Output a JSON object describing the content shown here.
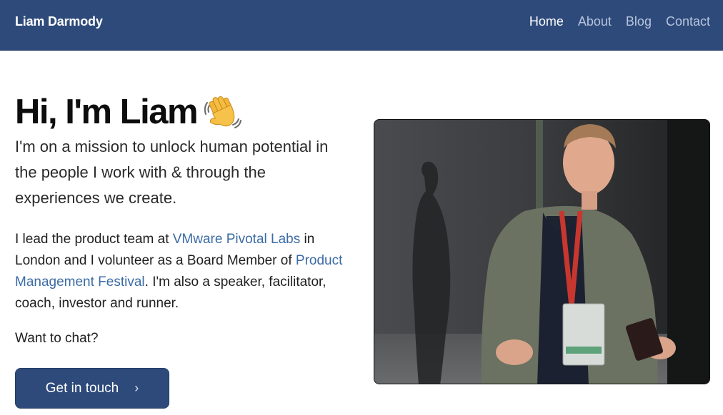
{
  "navbar": {
    "brand": "Liam Darmody",
    "links": [
      {
        "label": "Home",
        "active": true
      },
      {
        "label": "About",
        "active": false
      },
      {
        "label": "Blog",
        "active": false
      },
      {
        "label": "Contact",
        "active": false
      }
    ]
  },
  "hero": {
    "title": "Hi, I'm Liam",
    "wave_icon": "waving-hand-emoji",
    "tagline": "I'm on a mission to unlock human potential in the people I work with & through the experiences we create.",
    "bio": {
      "part1": "I lead the product team at ",
      "link1": "VMware Pivotal Labs",
      "part2": " in London and I volunteer as a Board Member of ",
      "link2": "Product Management Festival",
      "part3": ". I'm also a speaker, facilitator, coach, investor and runner."
    },
    "chat_prompt": "Want to chat?",
    "cta_label": "Get in touch",
    "cta_icon": "chevron-right-icon"
  },
  "photo": {
    "subject": "speaker-on-stage-photo"
  },
  "colors": {
    "navbar_bg": "#2d4a7a",
    "link": "#3b6ba5",
    "cta_bg": "#2d4a7a"
  }
}
